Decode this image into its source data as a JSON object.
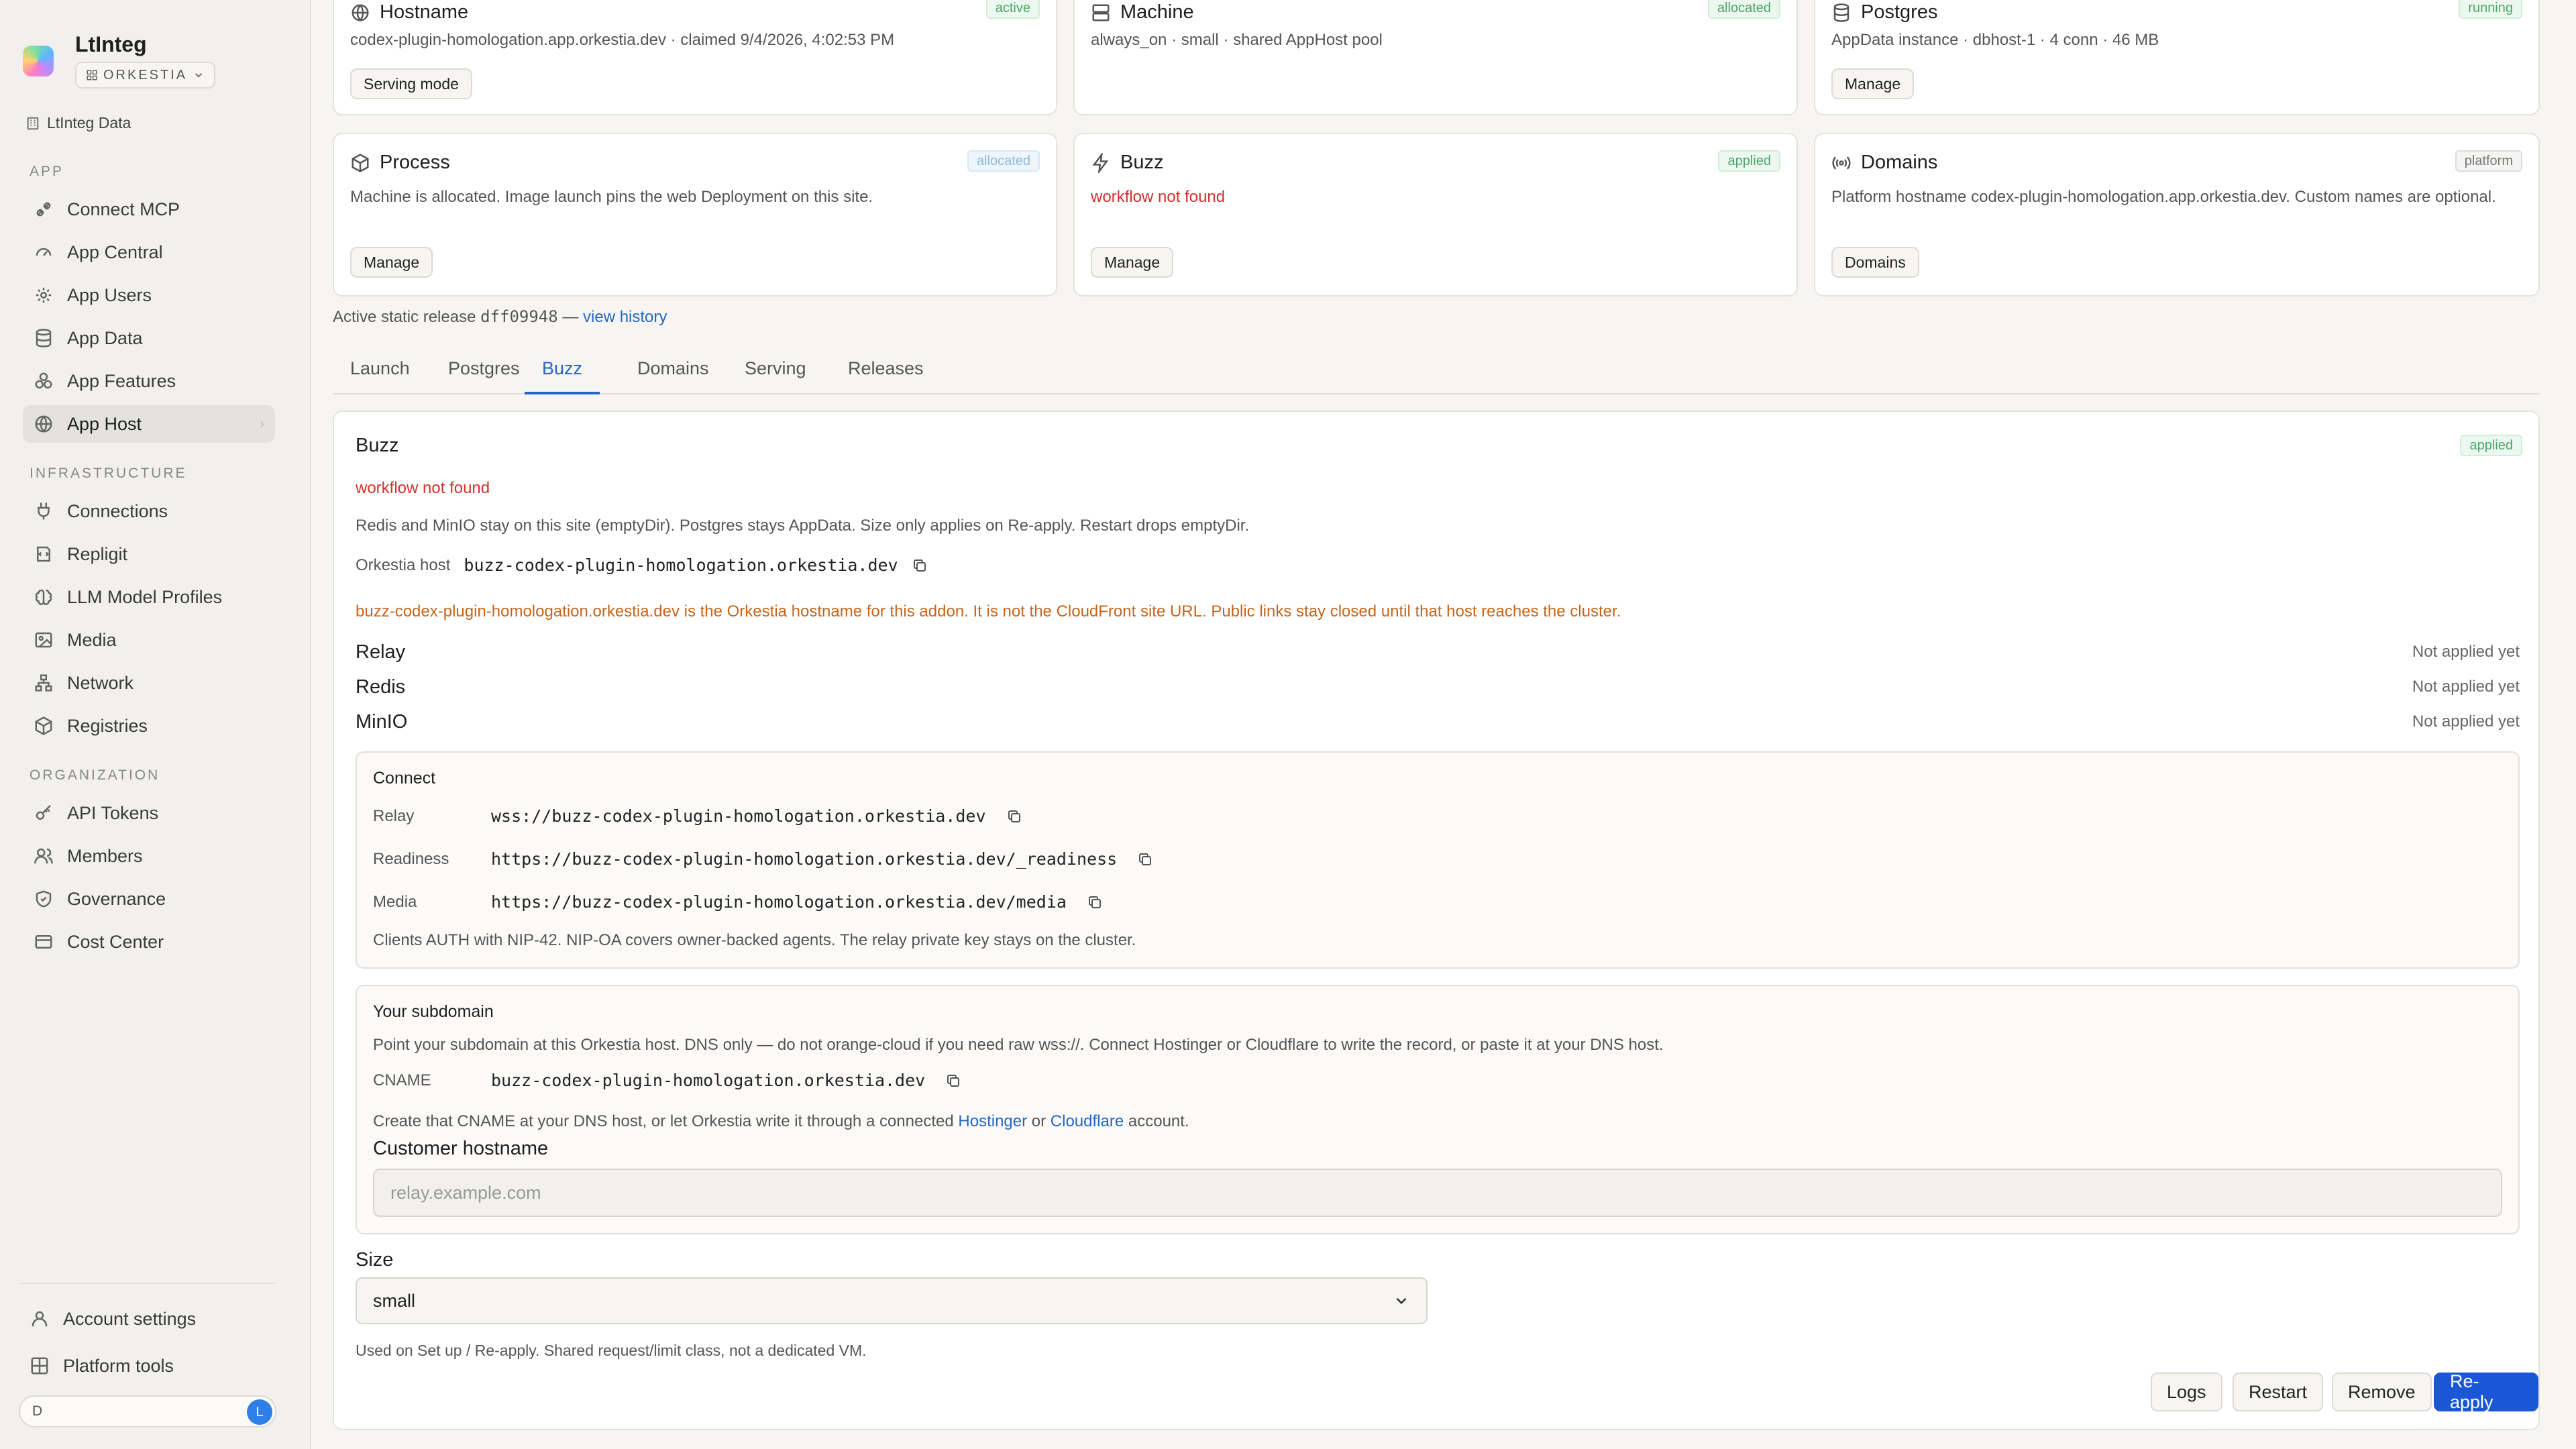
{
  "sidebar": {
    "brand": "LtInteg",
    "org": "ORKESTIA",
    "data_link": "LtInteg Data",
    "sections": {
      "app": "APP",
      "infrastructure": "INFRASTRUCTURE",
      "organization": "ORGANIZATION"
    },
    "app_items": [
      "Connect MCP",
      "App Central",
      "App Users",
      "App Data",
      "App Features",
      "App Host"
    ],
    "infra_items": [
      "Connections",
      "Repligit",
      "LLM Model Profiles",
      "Media",
      "Network",
      "Registries"
    ],
    "org_items": [
      "API Tokens",
      "Members",
      "Governance",
      "Cost Center"
    ],
    "footer_items": [
      "Account settings",
      "Platform tools"
    ],
    "search_value": "D",
    "avatar_letter": "L",
    "active_item": "App Host"
  },
  "cards": {
    "hostname": {
      "title": "Hostname",
      "badge": "active",
      "desc": "codex-plugin-homologation.app.orkestia.dev · claimed 9/4/2026, 4:02:53 PM",
      "button": "Serving mode"
    },
    "machine": {
      "title": "Machine",
      "badge": "allocated",
      "desc": "always_on · small · shared AppHost pool"
    },
    "postgres": {
      "title": "Postgres",
      "badge": "running",
      "desc": "AppData instance · dbhost-1 · 4 conn · 46 MB",
      "button": "Manage"
    },
    "process": {
      "title": "Process",
      "badge": "allocated",
      "desc": "Machine is allocated. Image launch pins the web Deployment on this site.",
      "button": "Manage"
    },
    "buzz": {
      "title": "Buzz",
      "badge": "applied",
      "desc": "workflow not found",
      "button": "Manage"
    },
    "domains": {
      "title": "Domains",
      "badge": "platform",
      "desc": "Platform hostname codex-plugin-homologation.app.orkestia.dev. Custom names are optional.",
      "button": "Domains"
    }
  },
  "static_release": {
    "prefix": "Active static release",
    "hash": "dff09948",
    "sep": "—",
    "link": "view history"
  },
  "tabs": [
    "Launch",
    "Postgres",
    "Buzz",
    "Domains",
    "Serving",
    "Releases"
  ],
  "active_tab": "Buzz",
  "panel": {
    "title": "Buzz",
    "badge": "applied",
    "error": "workflow not found",
    "note": "Redis and MinIO stay on this site (emptyDir). Postgres stays AppData. Size only applies on Re-apply. Restart drops emptyDir.",
    "host_label": "Orkestia host",
    "host_value": "buzz-codex-plugin-homologation.orkestia.dev",
    "warning": "buzz-codex-plugin-homologation.orkestia.dev is the Orkestia hostname for this addon. It is not the CloudFront site URL. Public links stay closed until that host reaches the cluster.",
    "services": [
      {
        "name": "Relay",
        "status": "Not applied yet"
      },
      {
        "name": "Redis",
        "status": "Not applied yet"
      },
      {
        "name": "MinIO",
        "status": "Not applied yet"
      }
    ],
    "connect": {
      "title": "Connect",
      "rows": [
        {
          "k": "Relay",
          "v": "wss://buzz-codex-plugin-homologation.orkestia.dev"
        },
        {
          "k": "Readiness",
          "v": "https://buzz-codex-plugin-homologation.orkestia.dev/_readiness"
        },
        {
          "k": "Media",
          "v": "https://buzz-codex-plugin-homologation.orkestia.dev/media"
        }
      ],
      "note": "Clients AUTH with NIP-42. NIP-OA covers owner-backed agents. The relay private key stays on the cluster."
    },
    "subdomain": {
      "title": "Your subdomain",
      "note": "Point your subdomain at this Orkestia host. DNS only — do not orange-cloud if you need raw wss://. Connect Hostinger or Cloudflare to write the record, or paste it at your DNS host.",
      "cname_label": "CNAME",
      "cname_value": "buzz-codex-plugin-homologation.orkestia.dev",
      "create_prefix": "Create that CNAME at your DNS host, or let Orkestia write it through a connected",
      "link_hostinger": "Hostinger",
      "or": "or",
      "link_cloudflare": "Cloudflare",
      "create_suffix": "account.",
      "hostname_label": "Customer hostname",
      "hostname_placeholder": "relay.example.com"
    },
    "size_label": "Size",
    "size_value": "small",
    "size_help": "Used on Set up / Re-apply. Shared request/limit class, not a dedicated VM.",
    "actions": {
      "logs": "Logs",
      "restart": "Restart",
      "remove": "Remove",
      "reapply": "Re-apply"
    }
  },
  "colors": {
    "accent": "#2566c4",
    "primary_button": "#1a56d6",
    "error": "#d2322d",
    "warning": "#c7651a",
    "badge_green": "#4ba567"
  }
}
